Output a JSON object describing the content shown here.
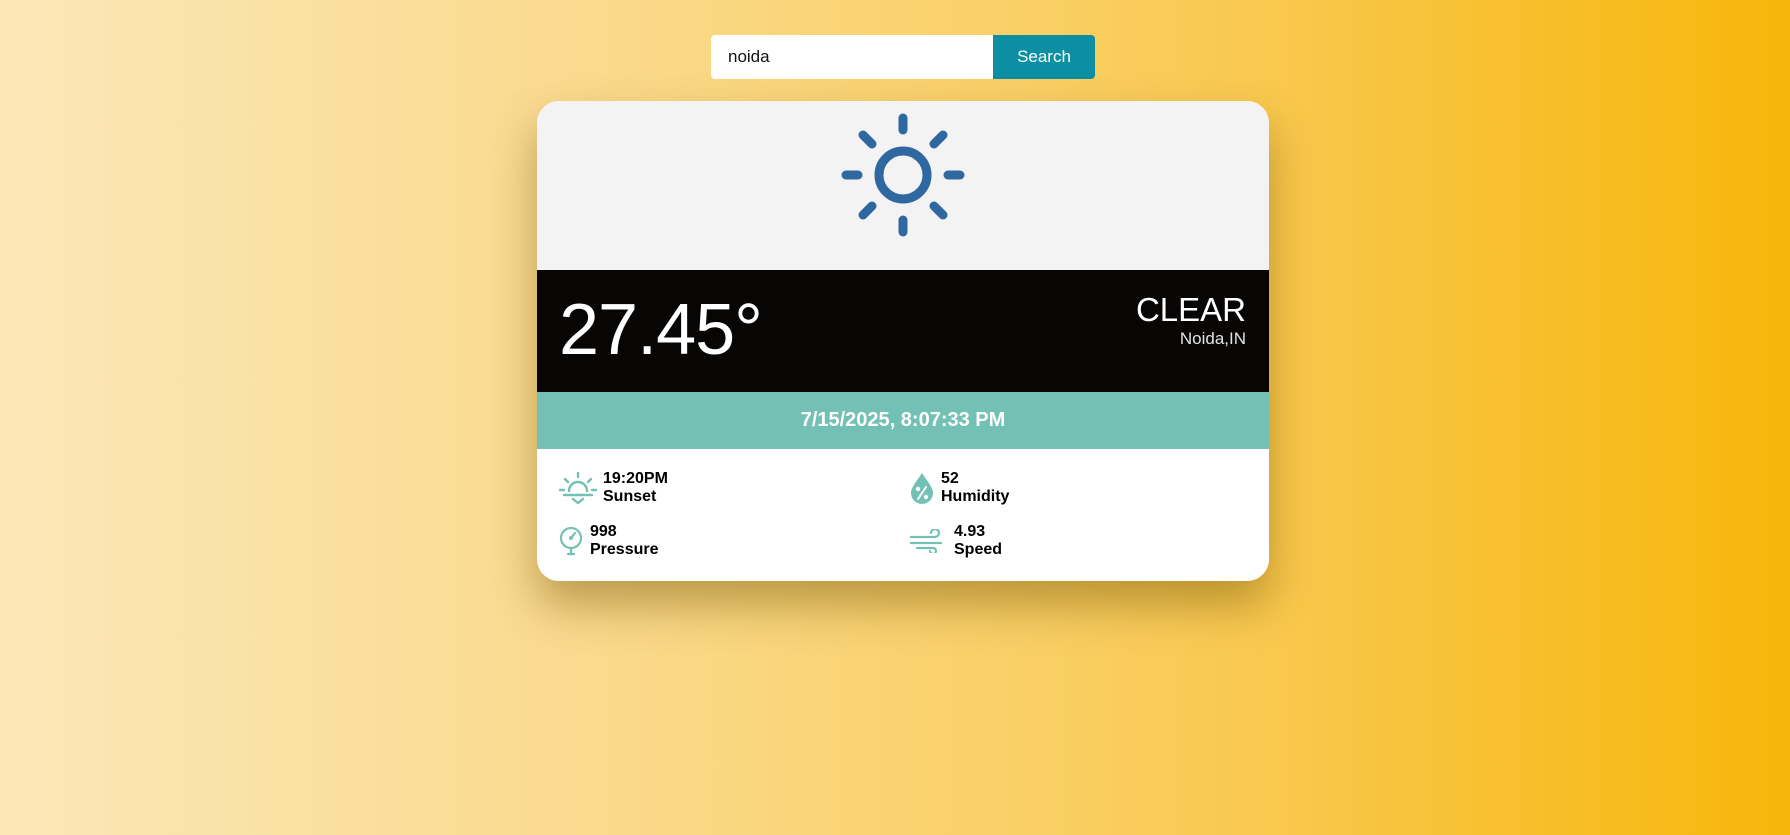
{
  "search": {
    "value": "noida",
    "button_label": "Search"
  },
  "weather": {
    "icon": "sun-icon",
    "temperature": "27.45°",
    "condition": "CLEAR",
    "location": "Noida,IN",
    "datetime": "7/15/2025, 8:07:33 PM"
  },
  "details": {
    "sunset": {
      "value": "19:20PM",
      "label": "Sunset",
      "icon": "sunset-icon"
    },
    "humidity": {
      "value": "52",
      "label": "Humidity",
      "icon": "humidity-icon"
    },
    "pressure": {
      "value": "998",
      "label": "Pressure",
      "icon": "pressure-gauge-icon"
    },
    "speed": {
      "value": "4.93",
      "label": "Speed",
      "icon": "wind-icon"
    }
  },
  "colors": {
    "search_button": "#0c8ea3",
    "sun_icon": "#2f67a0",
    "date_band": "#72c1b4",
    "detail_icons": "#72c1b4",
    "temperature_band": "#070605"
  }
}
